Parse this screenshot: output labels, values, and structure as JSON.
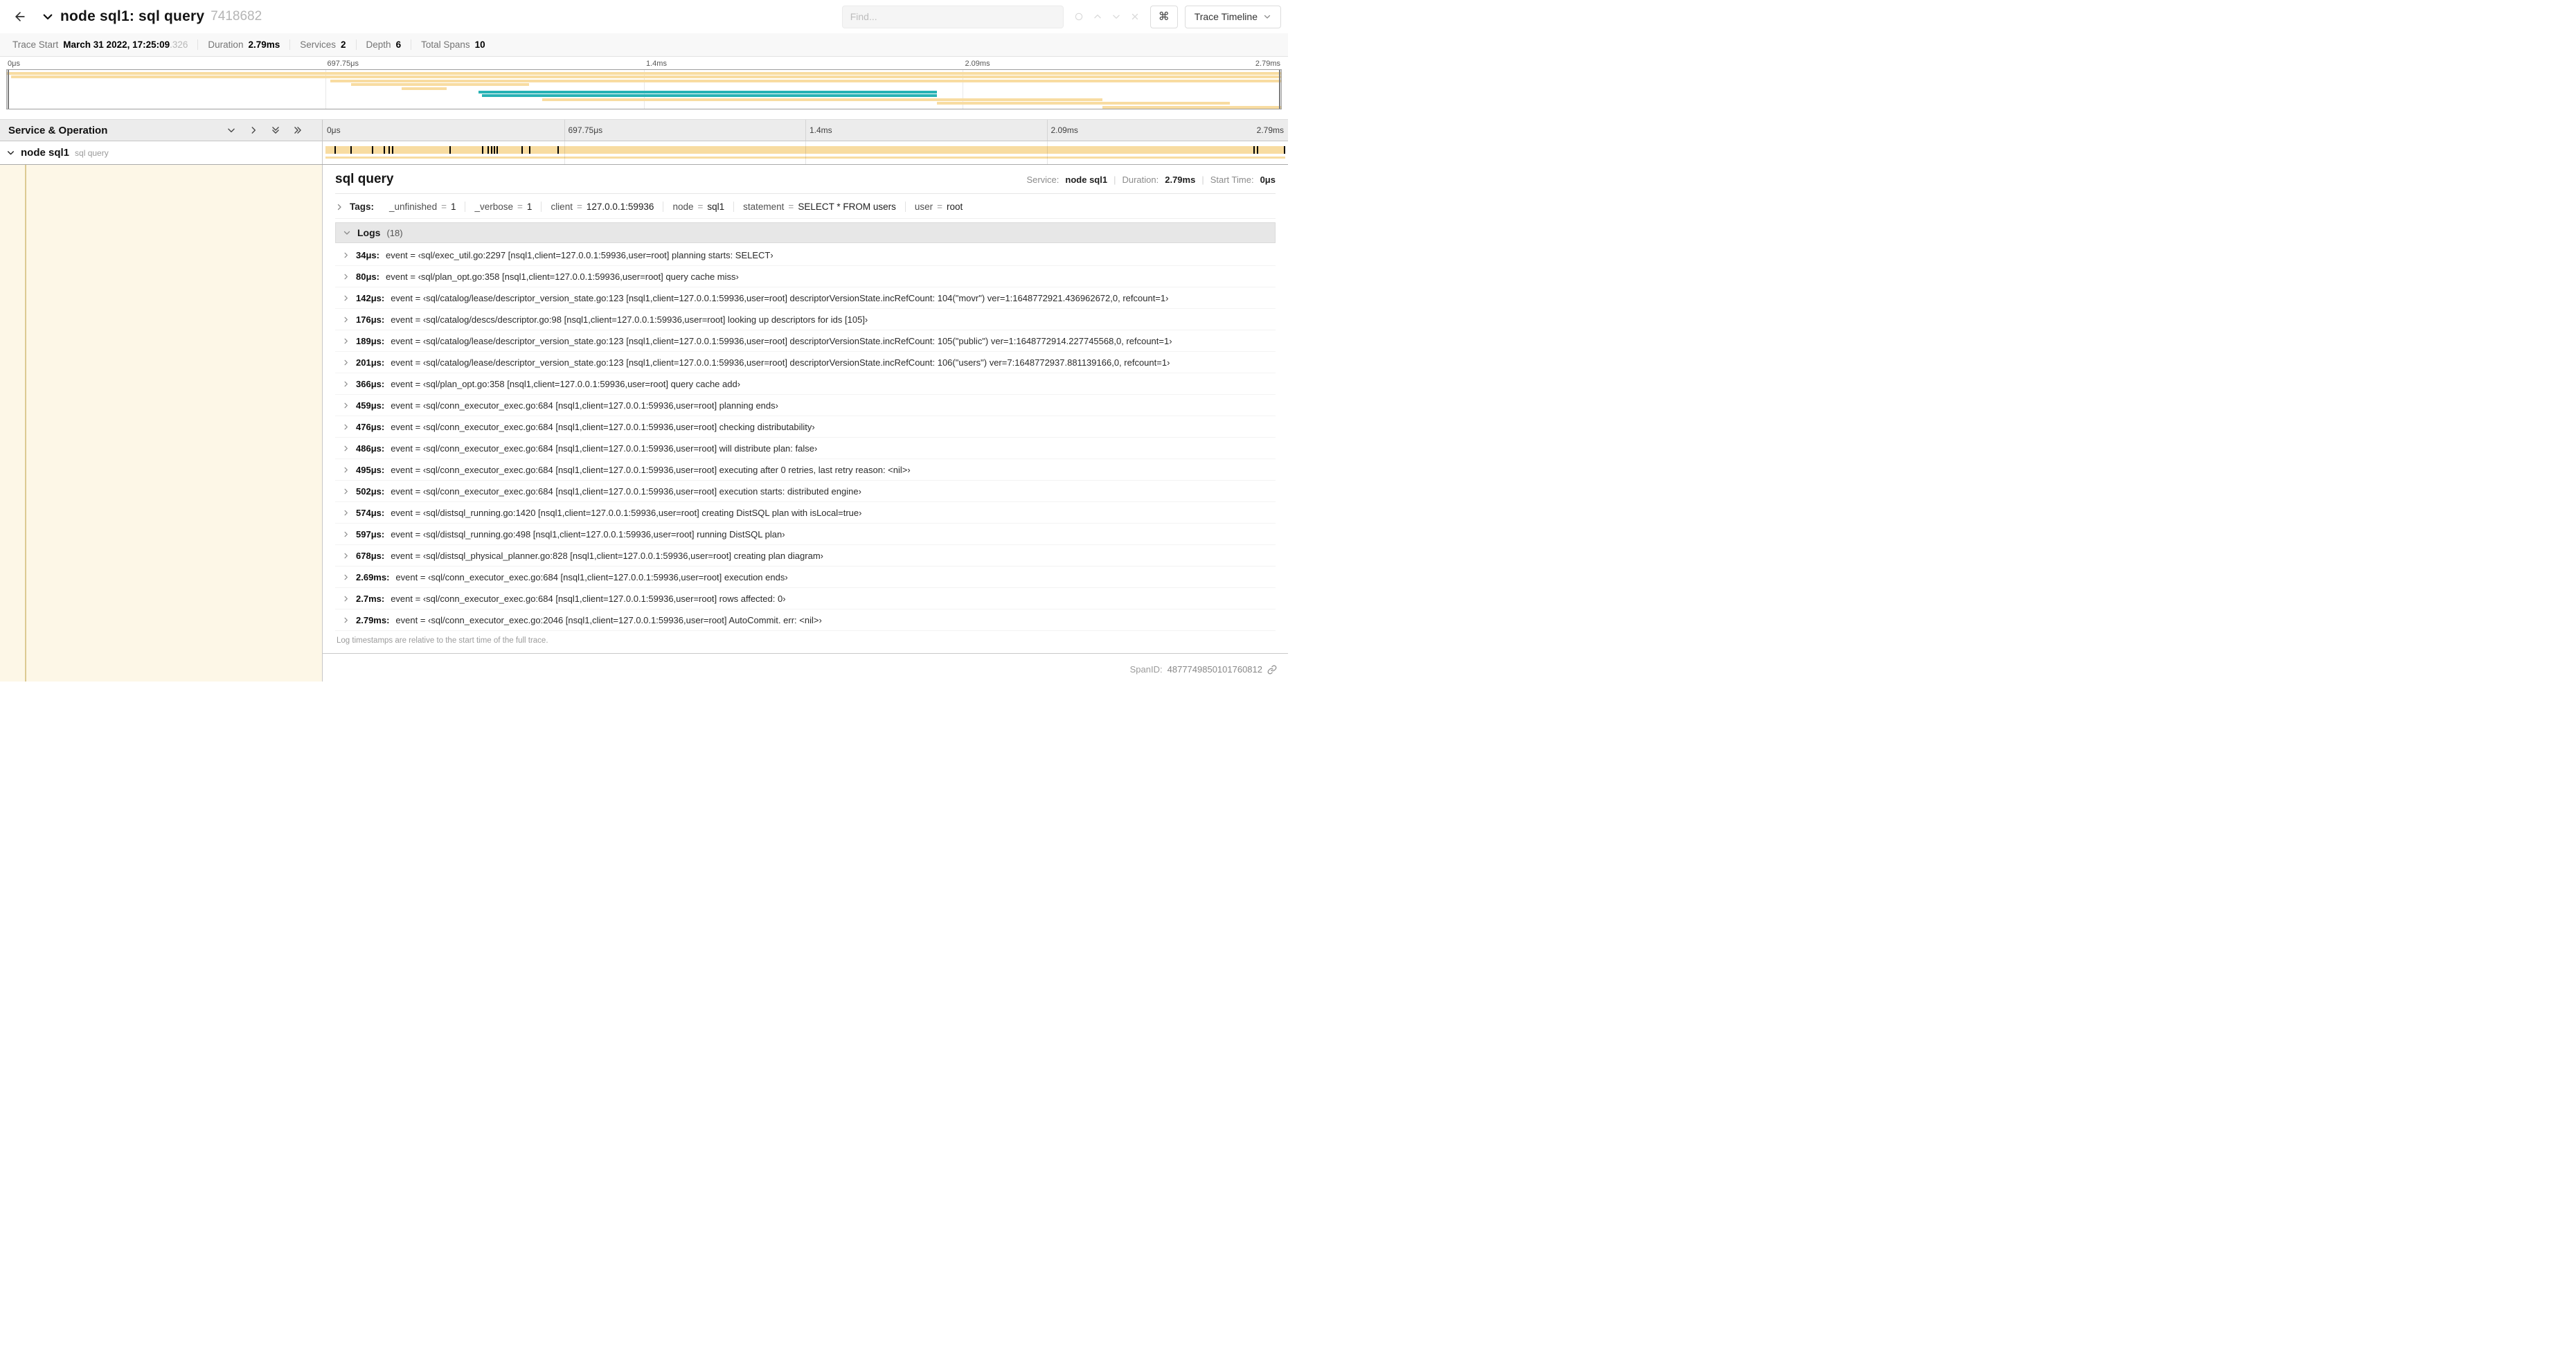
{
  "colors": {
    "span": "#f8dca1",
    "teal": "#28b2b5",
    "selected_row_bg": "#fdf7e7"
  },
  "header": {
    "title": "node sql1: sql query",
    "trace_id": "7418682",
    "find_placeholder": "Find...",
    "shortcut_key": "⌘",
    "view_select_label": "Trace Timeline"
  },
  "summary": {
    "items": [
      {
        "label": "Trace Start",
        "value": "March 31 2022, 17:25:09",
        "suffix": ".326"
      },
      {
        "label": "Duration",
        "value": "2.79ms",
        "suffix": ""
      },
      {
        "label": "Services",
        "value": "2",
        "suffix": ""
      },
      {
        "label": "Depth",
        "value": "6",
        "suffix": ""
      },
      {
        "label": "Total Spans",
        "value": "10",
        "suffix": ""
      }
    ]
  },
  "minimap": {
    "ticks": [
      "0μs",
      "697.75μs",
      "1.4ms",
      "2.09ms",
      "2.79ms"
    ],
    "bars": [
      {
        "start": 0,
        "end": 100,
        "color": "span"
      },
      {
        "start": 0.3,
        "end": 100,
        "color": "span"
      },
      {
        "start": 25.4,
        "end": 100,
        "color": "span"
      },
      {
        "start": 27,
        "end": 41,
        "color": "span"
      },
      {
        "start": 31,
        "end": 34.5,
        "color": "span"
      },
      {
        "start": 37,
        "end": 73,
        "color": "teal"
      },
      {
        "start": 37.3,
        "end": 73,
        "color": "teal"
      },
      {
        "start": 42,
        "end": 86,
        "color": "span"
      },
      {
        "start": 73,
        "end": 96,
        "color": "span"
      },
      {
        "start": 86,
        "end": 100,
        "color": "span"
      }
    ]
  },
  "timeline": {
    "left_header": "Service & Operation",
    "ticks": [
      "0μs",
      "697.75μs",
      "1.4ms",
      "2.09ms",
      "2.79ms"
    ],
    "span": {
      "service": "node sql1",
      "operation": "sql query"
    },
    "log_ticks": [
      1.2,
      2.9,
      5.1,
      6.3,
      6.8,
      7.2,
      13.1,
      16.5,
      17.1,
      17.4,
      17.7,
      18.0,
      20.6,
      21.4,
      24.3,
      96.4,
      96.8,
      99.6
    ]
  },
  "detail": {
    "title": "sql query",
    "meta": [
      {
        "label": "Service:",
        "value": "node sql1"
      },
      {
        "label": "Duration:",
        "value": "2.79ms"
      },
      {
        "label": "Start Time:",
        "value": "0μs"
      }
    ],
    "meta_separator": "|",
    "tags_label": "Tags:",
    "tag_separator": "=",
    "tags": [
      {
        "key": "_unfinished",
        "value": "1"
      },
      {
        "key": "_verbose",
        "value": "1"
      },
      {
        "key": "client",
        "value": "127.0.0.1:59936"
      },
      {
        "key": "node",
        "value": "sql1"
      },
      {
        "key": "statement",
        "value": "SELECT * FROM users"
      },
      {
        "key": "user",
        "value": "root"
      }
    ],
    "logs_label": "Logs",
    "logs_count": "(18)",
    "logs": [
      {
        "time": "34μs:",
        "text": "event = ‹sql/exec_util.go:2297 [nsql1,client=127.0.0.1:59936,user=root] planning starts: SELECT›"
      },
      {
        "time": "80μs:",
        "text": "event = ‹sql/plan_opt.go:358 [nsql1,client=127.0.0.1:59936,user=root] query cache miss›"
      },
      {
        "time": "142μs:",
        "text": "event = ‹sql/catalog/lease/descriptor_version_state.go:123 [nsql1,client=127.0.0.1:59936,user=root] descriptorVersionState.incRefCount: 104(\"movr\") ver=1:1648772921.436962672,0, refcount=1›"
      },
      {
        "time": "176μs:",
        "text": "event = ‹sql/catalog/descs/descriptor.go:98 [nsql1,client=127.0.0.1:59936,user=root] looking up descriptors for ids [105]›"
      },
      {
        "time": "189μs:",
        "text": "event = ‹sql/catalog/lease/descriptor_version_state.go:123 [nsql1,client=127.0.0.1:59936,user=root] descriptorVersionState.incRefCount: 105(\"public\") ver=1:1648772914.227745568,0, refcount=1›"
      },
      {
        "time": "201μs:",
        "text": "event = ‹sql/catalog/lease/descriptor_version_state.go:123 [nsql1,client=127.0.0.1:59936,user=root] descriptorVersionState.incRefCount: 106(\"users\") ver=7:1648772937.881139166,0, refcount=1›"
      },
      {
        "time": "366μs:",
        "text": "event = ‹sql/plan_opt.go:358 [nsql1,client=127.0.0.1:59936,user=root] query cache add›"
      },
      {
        "time": "459μs:",
        "text": "event = ‹sql/conn_executor_exec.go:684 [nsql1,client=127.0.0.1:59936,user=root] planning ends›"
      },
      {
        "time": "476μs:",
        "text": "event = ‹sql/conn_executor_exec.go:684 [nsql1,client=127.0.0.1:59936,user=root] checking distributability›"
      },
      {
        "time": "486μs:",
        "text": "event = ‹sql/conn_executor_exec.go:684 [nsql1,client=127.0.0.1:59936,user=root] will distribute plan: false›"
      },
      {
        "time": "495μs:",
        "text": "event = ‹sql/conn_executor_exec.go:684 [nsql1,client=127.0.0.1:59936,user=root] executing after 0 retries, last retry reason: <nil>›"
      },
      {
        "time": "502μs:",
        "text": "event = ‹sql/conn_executor_exec.go:684 [nsql1,client=127.0.0.1:59936,user=root] execution starts: distributed engine›"
      },
      {
        "time": "574μs:",
        "text": "event = ‹sql/distsql_running.go:1420 [nsql1,client=127.0.0.1:59936,user=root] creating DistSQL plan with isLocal=true›"
      },
      {
        "time": "597μs:",
        "text": "event = ‹sql/distsql_running.go:498 [nsql1,client=127.0.0.1:59936,user=root] running DistSQL plan›"
      },
      {
        "time": "678μs:",
        "text": "event = ‹sql/distsql_physical_planner.go:828 [nsql1,client=127.0.0.1:59936,user=root] creating plan diagram›"
      },
      {
        "time": "2.69ms:",
        "text": "event = ‹sql/conn_executor_exec.go:684 [nsql1,client=127.0.0.1:59936,user=root] execution ends›"
      },
      {
        "time": "2.7ms:",
        "text": "event = ‹sql/conn_executor_exec.go:684 [nsql1,client=127.0.0.1:59936,user=root] rows affected: 0›"
      },
      {
        "time": "2.79ms:",
        "text": "event = ‹sql/conn_executor_exec.go:2046 [nsql1,client=127.0.0.1:59936,user=root] AutoCommit. err: <nil>›"
      }
    ],
    "logs_note": "Log timestamps are relative to the start time of the full trace.",
    "span_id_label": "SpanID:",
    "span_id": "4877749850101760812"
  }
}
